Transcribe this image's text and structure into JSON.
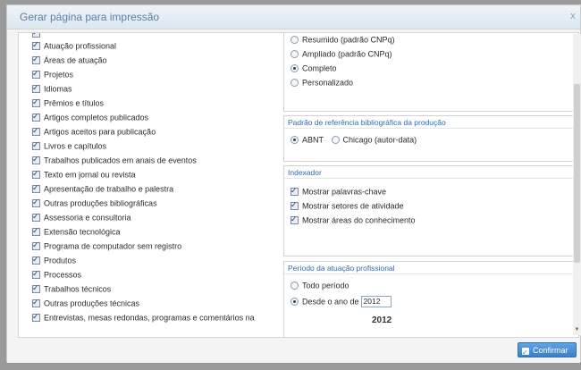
{
  "dialog": {
    "title": "Gerar página para impressão",
    "close_glyph": "x"
  },
  "left_items": [
    {
      "label": "Atuação profissional",
      "checked": true
    },
    {
      "label": "Áreas de atuação",
      "checked": true
    },
    {
      "label": "Projetos",
      "checked": true
    },
    {
      "label": "Idiomas",
      "checked": true
    },
    {
      "label": "Prêmios e títulos",
      "checked": true
    },
    {
      "label": "Artigos completos publicados",
      "checked": true
    },
    {
      "label": "Artigos aceitos para publicação",
      "checked": true
    },
    {
      "label": "Livros e capítulos",
      "checked": true
    },
    {
      "label": "Trabalhos publicados em anais de eventos",
      "checked": true
    },
    {
      "label": "Texto em jornal ou revista",
      "checked": true
    },
    {
      "label": "Apresentação de trabalho e palestra",
      "checked": true
    },
    {
      "label": "Outras produções bibliográficas",
      "checked": true
    },
    {
      "label": "Assessoria e consultoria",
      "checked": true
    },
    {
      "label": "Extensão tecnológica",
      "checked": true
    },
    {
      "label": "Programa de computador sem registro",
      "checked": true
    },
    {
      "label": "Produtos",
      "checked": true
    },
    {
      "label": "Processos",
      "checked": true
    },
    {
      "label": "Trabalhos técnicos",
      "checked": true
    },
    {
      "label": "Outras produções técnicas",
      "checked": true
    },
    {
      "label": "Entrevistas, mesas redondas, programas e comentários na",
      "checked": true
    }
  ],
  "format_section": {
    "options": [
      {
        "label": "Resumido (padrão CNPq)",
        "selected": false
      },
      {
        "label": "Ampliado (padrão CNPq)",
        "selected": false
      },
      {
        "label": "Completo",
        "selected": true
      },
      {
        "label": "Personalizado",
        "selected": false
      }
    ]
  },
  "reference_section": {
    "title": "Padrão de referência bibliográfica da produção",
    "options": [
      {
        "label": "ABNT",
        "selected": true
      },
      {
        "label": "Chicago (autor-data)",
        "selected": false
      }
    ]
  },
  "indexers_section": {
    "title": "Indexador",
    "options": [
      {
        "label": "Mostrar palavras-chave",
        "checked": true
      },
      {
        "label": "Mostrar setores de atividade",
        "checked": true
      },
      {
        "label": "Mostrar áreas do conhecimento",
        "checked": true
      }
    ]
  },
  "period_section": {
    "title": "Período da atuação profissional",
    "options": [
      {
        "label": "Todo período",
        "selected": false
      },
      {
        "label": "Desde o ano de",
        "selected": true
      }
    ],
    "year_value": "2012",
    "year_display": "2012"
  },
  "footer": {
    "confirm_label": "Confirmar"
  },
  "colors": {
    "accent": "#2e6bb0",
    "button": "#3b7fc8"
  }
}
